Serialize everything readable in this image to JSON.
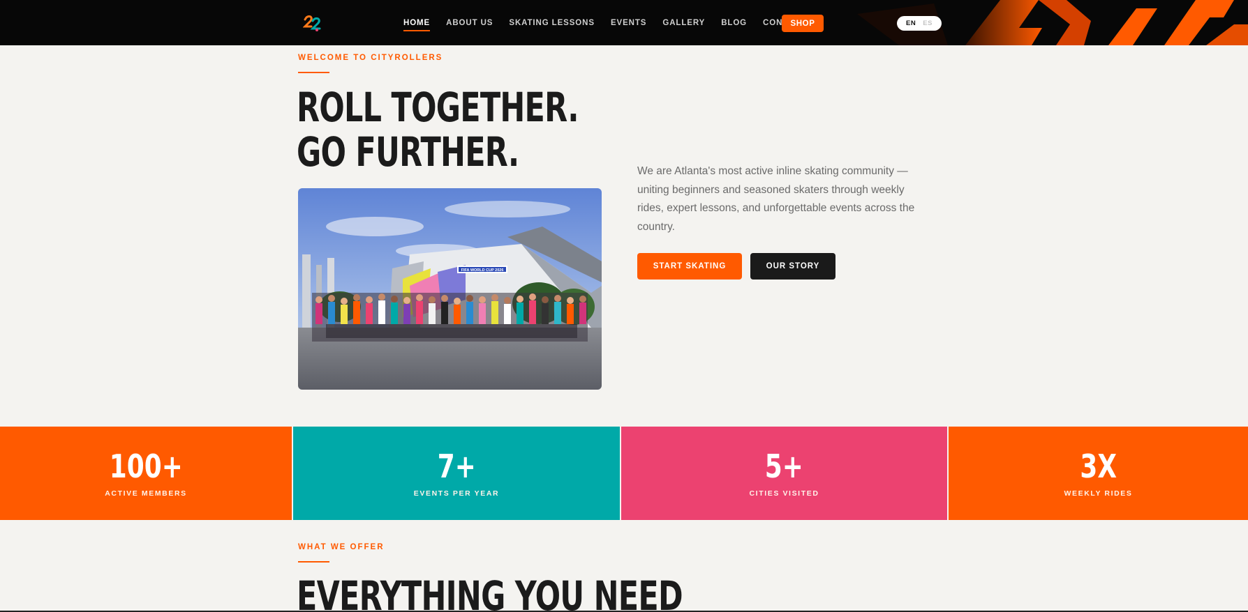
{
  "nav": {
    "logo_text": "22",
    "items": [
      {
        "label": "HOME",
        "active": true
      },
      {
        "label": "ABOUT US",
        "active": false
      },
      {
        "label": "SKATING LESSONS",
        "active": false
      },
      {
        "label": "EVENTS",
        "active": false
      },
      {
        "label": "GALLERY",
        "active": false
      },
      {
        "label": "BLOG",
        "active": false
      },
      {
        "label": "CONTACT",
        "active": false
      }
    ],
    "shop_label": "SHOP",
    "lang": {
      "current": "EN",
      "other": "ES"
    }
  },
  "hero": {
    "eyebrow": "WELCOME TO CITYROLLERS",
    "title_line1": "ROLL TOGETHER.",
    "title_line2": "GO FURTHER.",
    "photo_banner": "FIFA WORLD CUP 2026",
    "description": "We are Atlanta's most active inline skating community — uniting beginners and seasoned skaters through weekly rides, expert lessons, and unforgettable events across the country.",
    "primary_cta": "START SKATING",
    "secondary_cta": "OUR STORY"
  },
  "stats": [
    {
      "value": "100+",
      "label": "ACTIVE MEMBERS",
      "color": "#ff5a00"
    },
    {
      "value": "7+",
      "label": "EVENTS PER YEAR",
      "color": "#00a9a8"
    },
    {
      "value": "5+",
      "label": "CITIES VISITED",
      "color": "#ec4270"
    },
    {
      "value": "3X",
      "label": "WEEKLY RIDES",
      "color": "#ff5a00"
    }
  ],
  "offer": {
    "eyebrow": "WHAT WE OFFER",
    "title": "EVERYTHING YOU NEED"
  },
  "colors": {
    "accent": "#ff5a00",
    "teal": "#00a9a8",
    "pink": "#ec4270",
    "dark": "#1a1a1a",
    "background": "#f4f3f0"
  },
  "icons": {
    "logo": "cityrollers-logo-icon"
  }
}
